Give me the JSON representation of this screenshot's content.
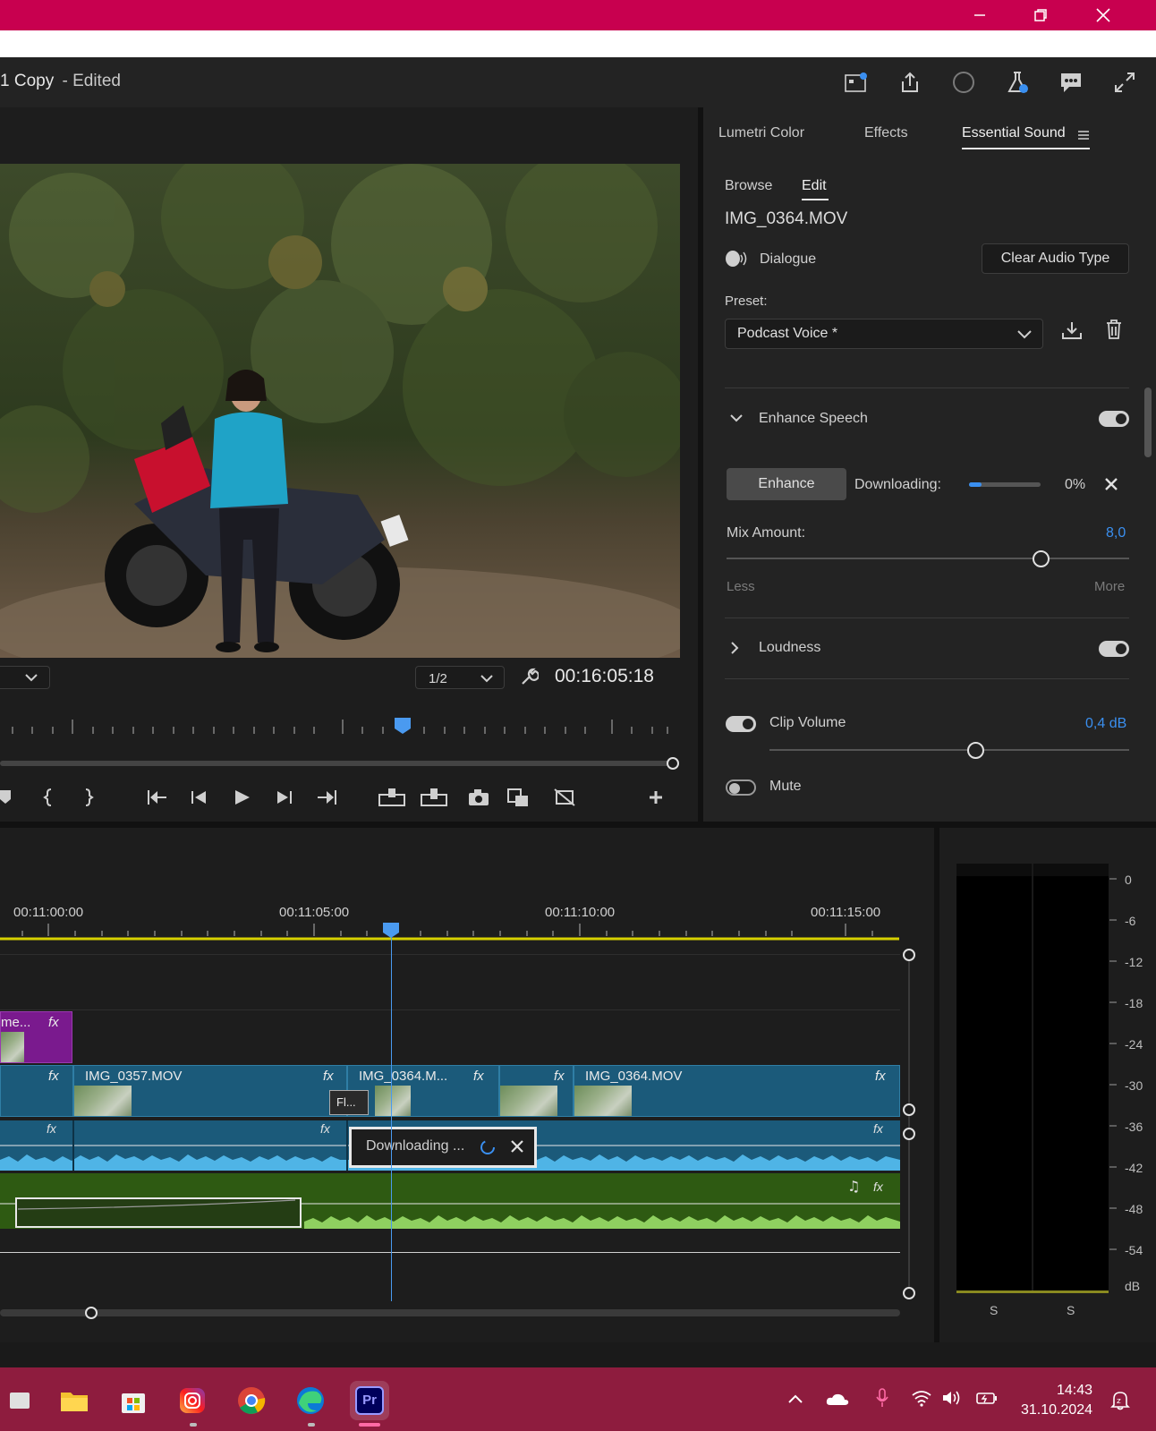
{
  "header": {
    "sequence_title": "1 Copy",
    "sequence_status": "- Edited"
  },
  "monitor": {
    "resolution": "1/2",
    "timecode": "00:16:05:18"
  },
  "panel": {
    "tabs": [
      "Lumetri Color",
      "Effects",
      "Essential Sound"
    ],
    "active_tab": "Essential Sound",
    "subtabs": [
      "Browse",
      "Edit"
    ],
    "clip_name": "IMG_0364.MOV",
    "audio_type": "Dialogue",
    "clear_button": "Clear Audio Type",
    "preset_label": "Preset:",
    "preset_value": "Podcast Voice *",
    "enhance_section": "Enhance Speech",
    "enhance_button": "Enhance",
    "downloading_label": "Downloading:",
    "download_percent": "0%",
    "download_progress": 0.18,
    "mix_label": "Mix Amount:",
    "mix_value": "8,0",
    "mix_less": "Less",
    "mix_more": "More",
    "loudness_section": "Loudness",
    "clip_volume_label": "Clip Volume",
    "clip_volume_value": "0,4 dB",
    "mute_label": "Mute"
  },
  "timeline": {
    "timecodes": [
      "00:11:00:00",
      "00:11:05:00",
      "00:11:10:00",
      "00:11:15:00"
    ],
    "clips": {
      "c0": "me...",
      "c1": "IMG_0357.MOV",
      "c2": "IMG_0364.M...",
      "c3": "IMG_0364.MOV",
      "c4": "Fl..."
    },
    "fx": "fx",
    "downloading_popup": "Downloading ..."
  },
  "meter": {
    "scale": [
      "0",
      "-6",
      "-12",
      "-18",
      "-24",
      "-30",
      "-36",
      "-42",
      "-48",
      "-54",
      "dB"
    ],
    "channels": [
      "S",
      "S"
    ]
  },
  "taskbar": {
    "time": "14:43",
    "date": "31.10.2024",
    "premiere_label": "Pr"
  },
  "colors": {
    "titlebar": "#c8004f",
    "accent_blue": "#3a8ff0",
    "video_clip": "#1b5a7a",
    "audio_green": "#2e5a12",
    "playhead": "#4a9af0"
  }
}
